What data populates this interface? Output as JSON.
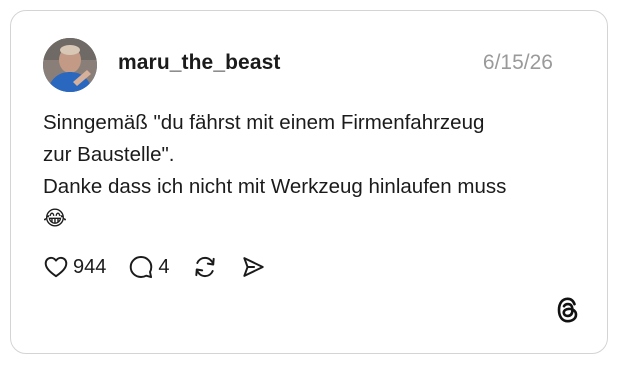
{
  "post": {
    "username": "maru_the_beast",
    "date": "6/15/26",
    "text_lines": [
      "Sinngemäß \"du fährst mit einem Firmenfahrzeug",
      "zur Baustelle\".",
      "Danke dass ich nicht mit Werkzeug hinlaufen muss",
      "😂"
    ],
    "likes": "944",
    "replies": "4"
  },
  "icons": {
    "like": "heart-icon",
    "reply": "comment-bubble-icon",
    "repost": "repost-icon",
    "share": "send-icon",
    "brand": "threads-logo-icon"
  }
}
